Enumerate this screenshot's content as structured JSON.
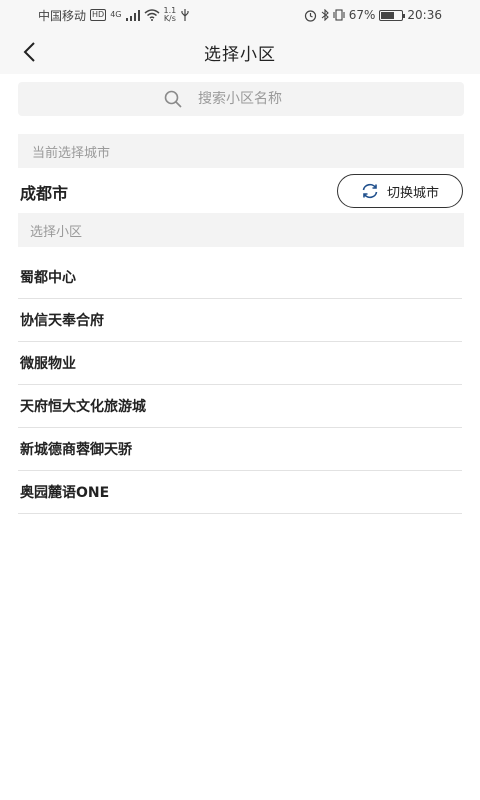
{
  "status_bar": {
    "carrier": "中国移动",
    "hd_badge": "HD",
    "network_type": "4G",
    "speed_value": "1.1",
    "speed_unit": "K/s",
    "battery_percent": "67%",
    "battery_level": 0.67,
    "time": "20:36"
  },
  "navbar": {
    "title": "选择小区"
  },
  "search": {
    "placeholder": "搜索小区名称"
  },
  "current_city_label": "当前选择城市",
  "current_city": "成都市",
  "switch_city_label": "切换城市",
  "choose_community_label": "选择小区",
  "communities": [
    "蜀都中心",
    "协信天奉合府",
    "微服物业",
    "天府恒大文化旅游城",
    "新城德商蓉御天骄",
    "奥园麓语ONE"
  ],
  "colors": {
    "background": "#ffffff",
    "header_bg": "#f7f7f7",
    "field_bg": "#f3f3f3",
    "placeholder": "#9a9a9a",
    "accent_blue": "#1f4f8c"
  },
  "icons": {
    "back": "chevron-left-icon",
    "search": "search-icon",
    "switch": "refresh-icon"
  }
}
